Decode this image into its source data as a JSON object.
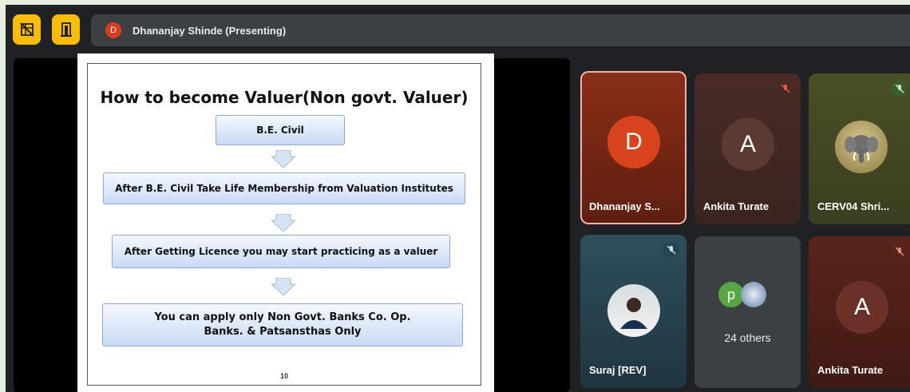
{
  "topbar": {
    "presenter_avatar_letter": "D",
    "presenter_label": "Dhananjay Shinde (Presenting)"
  },
  "slide": {
    "title": "How to become Valuer(Non govt. Valuer)",
    "steps": [
      "B.E. Civil",
      "After B.E. Civil Take Life Membership from Valuation Institutes",
      "After Getting Licence you may start practicing as a valuer",
      "You can apply only Non Govt. Banks Co. Op. Banks. & Patsansthas Only"
    ],
    "page_number": "10"
  },
  "participants": [
    {
      "letter": "D",
      "name": "Dhananjay S...",
      "muted": false,
      "active": true
    },
    {
      "letter": "A",
      "name": "Ankita Turate",
      "muted": true
    },
    {
      "letter": "",
      "name": "CERV04 Shri...",
      "muted": true
    },
    {
      "letter": "",
      "name": "Suraj [REV]",
      "muted": true
    },
    {
      "letter": "p",
      "name": "24 others"
    },
    {
      "letter": "A",
      "name": "Ankita Turate",
      "muted": true
    }
  ],
  "colors": {
    "accent_yellow": "#fbbc04",
    "presenter_red": "#d93c1e",
    "active_border": "#f2b3a6"
  }
}
